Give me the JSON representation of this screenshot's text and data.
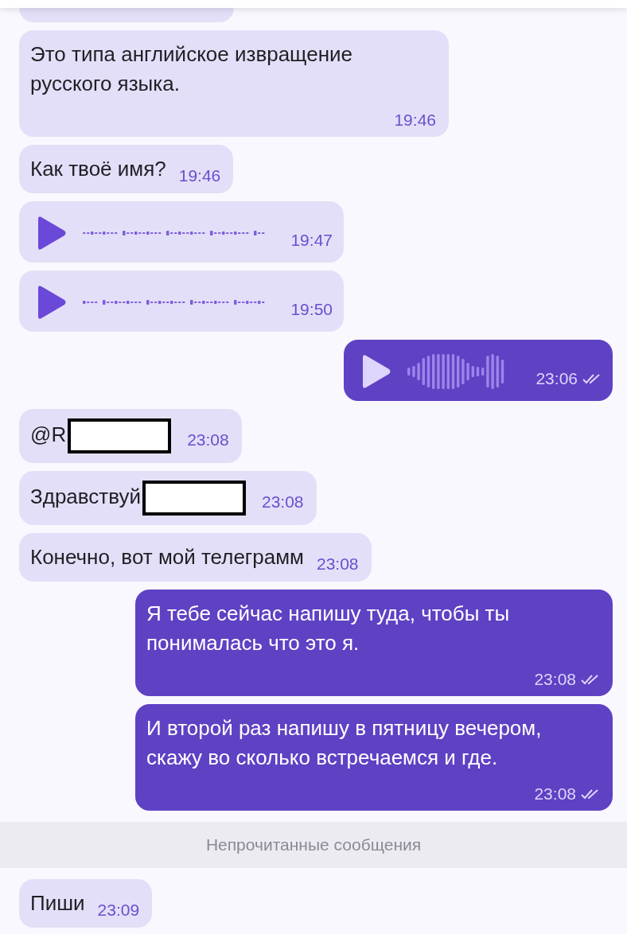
{
  "messages": [
    {
      "kind": "cut",
      "outgoing": false
    },
    {
      "kind": "text",
      "outgoing": false,
      "text": "Это типа английское извращение русского языка.",
      "time": "19:46"
    },
    {
      "kind": "text",
      "outgoing": false,
      "text": "Как твоё имя?",
      "time": "19:46"
    },
    {
      "kind": "voice",
      "outgoing": false,
      "time": "19:47"
    },
    {
      "kind": "voice",
      "outgoing": false,
      "time": "19:50"
    },
    {
      "kind": "voice",
      "outgoing": true,
      "time": "23:06",
      "read": true
    },
    {
      "kind": "text",
      "outgoing": false,
      "text": "@R",
      "time": "23:08",
      "redacted": true
    },
    {
      "kind": "text",
      "outgoing": false,
      "text": "Здравствуй",
      "time": "23:08",
      "redacted": true
    },
    {
      "kind": "text",
      "outgoing": false,
      "text": "Конечно, вот мой телеграмм",
      "time": "23:08"
    },
    {
      "kind": "text",
      "outgoing": true,
      "text": "Я тебе сейчас напишу туда, чтобы ты понималась что это я.",
      "time": "23:08",
      "read": true
    },
    {
      "kind": "text",
      "outgoing": true,
      "text": "И второй раз напишу в пятницу вечером, скажу во сколько встречаемся и где.",
      "time": "23:08",
      "read": true
    },
    {
      "kind": "divider",
      "text": "Непрочитанные сообщения"
    },
    {
      "kind": "text",
      "outgoing": false,
      "text": "Пиши",
      "time": "23:09"
    }
  ]
}
